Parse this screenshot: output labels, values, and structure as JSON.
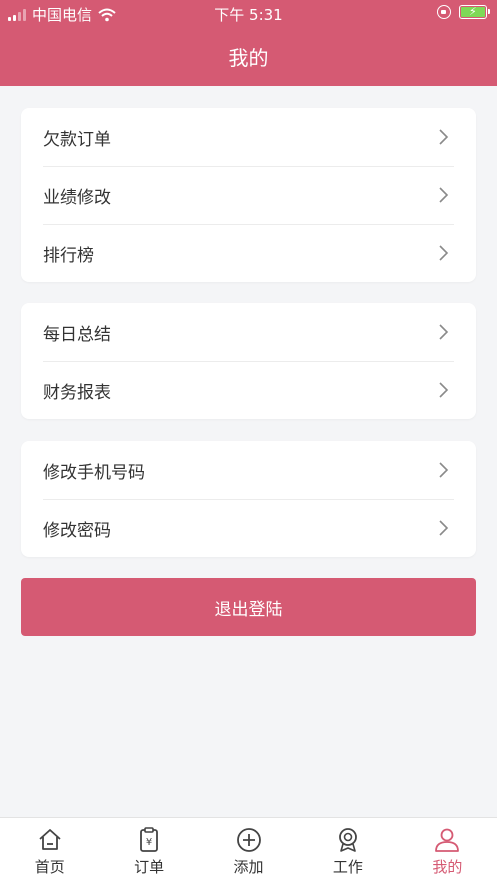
{
  "status_bar": {
    "carrier": "中国电信",
    "time": "下午 5:31"
  },
  "header": {
    "title": "我的"
  },
  "groups": [
    {
      "items": [
        {
          "label": "欠款订单"
        },
        {
          "label": "业绩修改"
        },
        {
          "label": "排行榜"
        }
      ]
    },
    {
      "items": [
        {
          "label": "每日总结"
        },
        {
          "label": "财务报表"
        }
      ]
    },
    {
      "items": [
        {
          "label": "修改手机号码"
        },
        {
          "label": "修改密码"
        }
      ]
    }
  ],
  "logout_label": "退出登陆",
  "tabbar": {
    "tabs": [
      {
        "label": "首页",
        "icon": "home-icon"
      },
      {
        "label": "订单",
        "icon": "order-clipboard-icon"
      },
      {
        "label": "添加",
        "icon": "add-circle-icon"
      },
      {
        "label": "工作",
        "icon": "work-icon"
      },
      {
        "label": "我的",
        "icon": "profile-icon",
        "active": true
      }
    ]
  },
  "colors": {
    "accent": "#d55a73",
    "background": "#f4f5f7"
  }
}
